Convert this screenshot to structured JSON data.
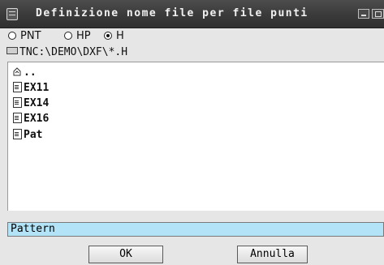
{
  "window": {
    "title": "Definizione nome file per file punti"
  },
  "file_type": {
    "options": [
      {
        "label": "PNT",
        "selected": false
      },
      {
        "label": "HP",
        "selected": false
      },
      {
        "label": "H",
        "selected": true
      }
    ]
  },
  "path": {
    "value": "TNC:\\DEMO\\DXF\\*.H"
  },
  "file_list": {
    "up_label": "..",
    "items": [
      {
        "name": "EX11"
      },
      {
        "name": "EX14"
      },
      {
        "name": "EX16"
      },
      {
        "name": "Pat"
      }
    ]
  },
  "filename_input": {
    "value": "Pattern"
  },
  "buttons": {
    "ok_label": "OK",
    "cancel_label": "Annulla"
  },
  "icons": {
    "window_icon": "window-icon",
    "minimize": "minimize-icon",
    "maximize": "maximize-icon",
    "drive": "drive-icon",
    "up_folder": "up-folder-icon",
    "file": "file-icon"
  }
}
